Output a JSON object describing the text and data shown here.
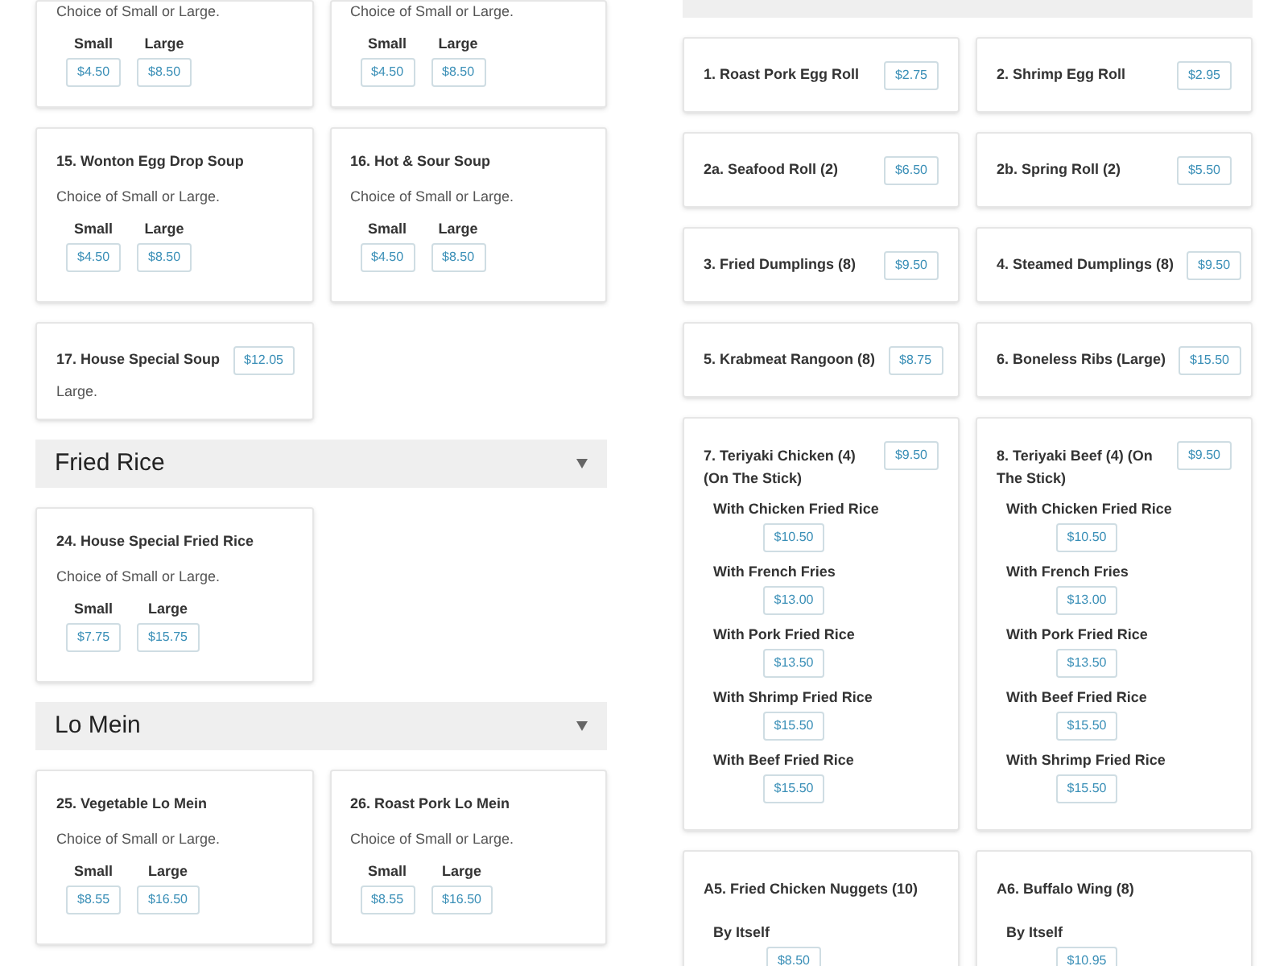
{
  "left_column": {
    "sections": [
      {
        "items": [
          {
            "kind": "sized",
            "description": "Choice of Small or Large.",
            "sizes": [
              {
                "label": "Small",
                "price": "$4.50"
              },
              {
                "label": "Large",
                "price": "$8.50"
              }
            ]
          },
          {
            "kind": "sized",
            "description": "Choice of Small or Large.",
            "sizes": [
              {
                "label": "Small",
                "price": "$4.50"
              },
              {
                "label": "Large",
                "price": "$8.50"
              }
            ]
          },
          {
            "kind": "sized",
            "name": "15. Wonton Egg Drop Soup",
            "description": "Choice of Small or Large.",
            "sizes": [
              {
                "label": "Small",
                "price": "$4.50"
              },
              {
                "label": "Large",
                "price": "$8.50"
              }
            ]
          },
          {
            "kind": "sized",
            "name": "16. Hot & Sour Soup",
            "description": "Choice of Small or Large.",
            "sizes": [
              {
                "label": "Small",
                "price": "$4.50"
              },
              {
                "label": "Large",
                "price": "$8.50"
              }
            ]
          },
          {
            "kind": "single",
            "name": "17. House Special Soup",
            "price": "$12.05",
            "description": "Large."
          }
        ]
      },
      {
        "title": "Fried Rice",
        "items": [
          {
            "kind": "sized",
            "name": "24. House Special Fried Rice",
            "description": "Choice of Small or Large.",
            "sizes": [
              {
                "label": "Small",
                "price": "$7.75"
              },
              {
                "label": "Large",
                "price": "$15.75"
              }
            ]
          }
        ]
      },
      {
        "title": "Lo Mein",
        "items": [
          {
            "kind": "sized",
            "name": "25. Vegetable Lo Mein",
            "description": "Choice of Small or Large.",
            "sizes": [
              {
                "label": "Small",
                "price": "$8.55"
              },
              {
                "label": "Large",
                "price": "$16.50"
              }
            ]
          },
          {
            "kind": "sized",
            "name": "26. Roast Pork Lo Mein",
            "description": "Choice of Small or Large.",
            "sizes": [
              {
                "label": "Small",
                "price": "$8.55"
              },
              {
                "label": "Large",
                "price": "$16.50"
              }
            ]
          }
        ]
      }
    ]
  },
  "right_column": {
    "items": [
      {
        "kind": "single",
        "name": "1. Roast Pork Egg Roll",
        "price": "$2.75"
      },
      {
        "kind": "single",
        "name": "2. Shrimp Egg Roll",
        "price": "$2.95"
      },
      {
        "kind": "single",
        "name": "2a. Seafood Roll (2)",
        "price": "$6.50"
      },
      {
        "kind": "single",
        "name": "2b. Spring Roll (2)",
        "price": "$5.50"
      },
      {
        "kind": "single",
        "name": "3. Fried Dumplings (8)",
        "price": "$9.50"
      },
      {
        "kind": "single",
        "name": "4. Steamed Dumplings (8)",
        "price": "$9.50"
      },
      {
        "kind": "single",
        "name": "5. Krabmeat Rangoon (8)",
        "price": "$8.75"
      },
      {
        "kind": "single",
        "name": "6. Boneless Ribs (Large)",
        "price": "$15.50"
      },
      {
        "kind": "options",
        "name": "7. Teriyaki Chicken (4) (On The Stick)",
        "price": "$9.50",
        "options": [
          {
            "label": "With Chicken Fried Rice",
            "price": "$10.50"
          },
          {
            "label": "With French Fries",
            "price": "$13.00"
          },
          {
            "label": "With Pork Fried Rice",
            "price": "$13.50"
          },
          {
            "label": "With Shrimp Fried Rice",
            "price": "$15.50"
          },
          {
            "label": "With Beef Fried Rice",
            "price": "$15.50"
          }
        ]
      },
      {
        "kind": "options",
        "name": "8. Teriyaki Beef (4) (On The Stick)",
        "price": "$9.50",
        "options": [
          {
            "label": "With Chicken Fried Rice",
            "price": "$10.50"
          },
          {
            "label": "With French Fries",
            "price": "$13.00"
          },
          {
            "label": "With Pork Fried Rice",
            "price": "$13.50"
          },
          {
            "label": "With Beef Fried Rice",
            "price": "$15.50"
          },
          {
            "label": "With Shrimp Fried Rice",
            "price": "$15.50"
          }
        ]
      },
      {
        "kind": "options",
        "name": "A5. Fried Chicken Nuggets (10)",
        "options": [
          {
            "label": "By Itself",
            "price": "$8.50"
          }
        ]
      },
      {
        "kind": "options",
        "name": "A6. Buffalo Wing (8)",
        "options": [
          {
            "label": "By Itself",
            "price": "$10.95"
          }
        ]
      }
    ]
  }
}
